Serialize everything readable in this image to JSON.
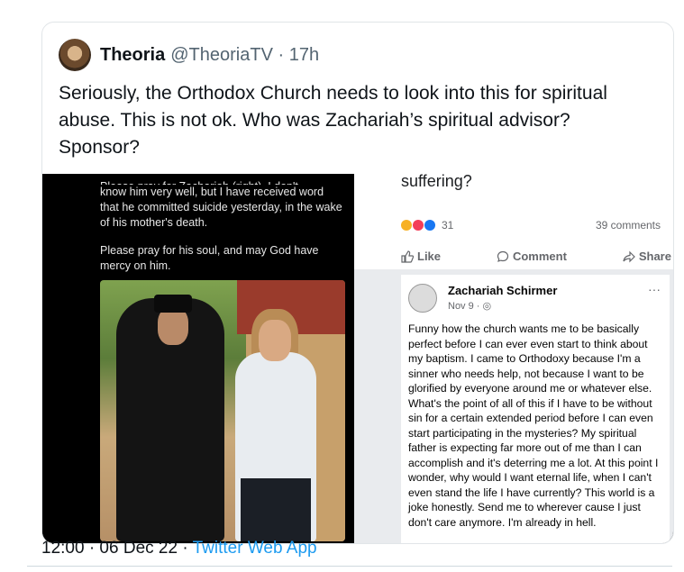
{
  "tweet": {
    "author_name": "Theoria",
    "handle_time": "@TheoriaTV · 17h",
    "text": "Seriously, the Orthodox Church needs to look into this for spiritual abuse. This is not ok. Who was Zachariah’s spiritual advisor? Sponsor?"
  },
  "embed_left": {
    "cut_line": "Please pray for Zachariah (right). I don't",
    "paragraph1": "know him very well, but I have received word that he committed suicide yesterday, in the wake of his mother's death.",
    "paragraph2": "Please pray for his soul, and may God have mercy on him."
  },
  "embed_right": {
    "cut_heading": "suffering?",
    "reaction_count": "31",
    "comments": "39 comments",
    "actions": {
      "like": "Like",
      "comment": "Comment",
      "share": "Share"
    },
    "post": {
      "author": "Zachariah Schirmer",
      "date": "Nov 9 · ◎",
      "more": "···",
      "text": "Funny how the church wants me to be basically perfect before I can ever even start to think about my baptism. I came to Orthodoxy because I'm a sinner who needs help, not because I want to be glorified by everyone around me or whatever else. What's the point of all of this if I have to be without sin for a certain extended period before I can even start participating in the mysteries? My spiritual father is expecting far more out of me than I can accomplish and it's deterring me a lot. At this point I wonder, why would I want eternal life, when I can't even stand the life I have currently? This world is a joke honestly. Send me to wherever cause I just don't care anymore. I'm already in hell."
    }
  },
  "footer": {
    "time": "12:00 · 06 Dec 22 · ",
    "source": "Twitter Web App"
  },
  "colors": {
    "link": "#1d9bf0",
    "muted": "#536471"
  }
}
